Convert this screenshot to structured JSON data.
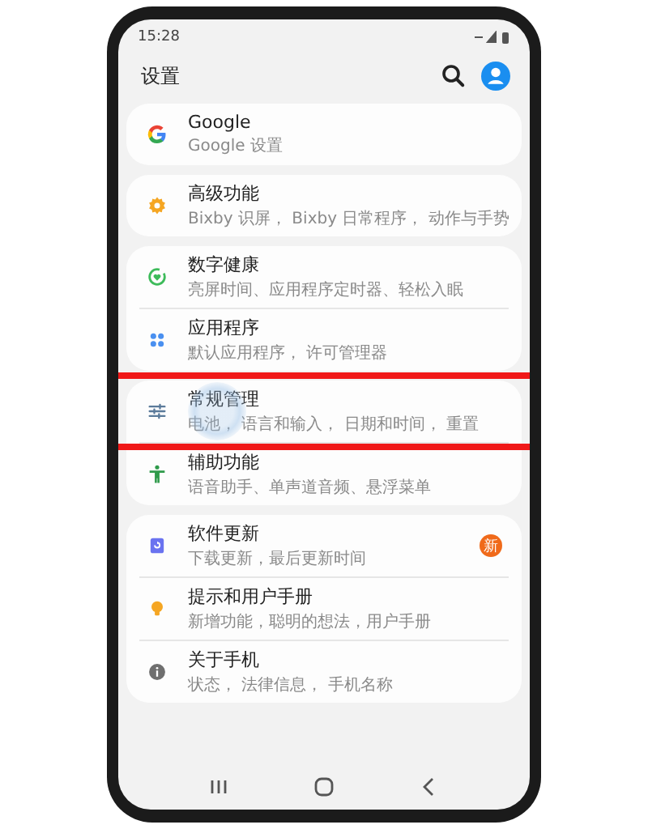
{
  "status_bar": {
    "time": "15:28"
  },
  "header": {
    "title": "设置"
  },
  "groups": [
    {
      "items": [
        {
          "kind": "google",
          "title": "Google",
          "subtitle": "Google 设置",
          "highlighted": false
        }
      ]
    },
    {
      "items": [
        {
          "kind": "gear",
          "title": "高级功能",
          "subtitle": "Bixby 识屏， Bixby 日常程序， 动作与手势",
          "highlighted": false
        }
      ]
    },
    {
      "items": [
        {
          "kind": "wellbeing",
          "title": "数字健康",
          "subtitle": "亮屏时间、应用程序定时器、轻松入眠",
          "highlighted": false
        },
        {
          "kind": "apps",
          "title": "应用程序",
          "subtitle": "默认应用程序， 许可管理器",
          "highlighted": false
        }
      ]
    },
    {
      "items": [
        {
          "kind": "sliders",
          "title": "常规管理",
          "subtitle": "电池， 语言和输入， 日期和时间， 重置",
          "highlighted": true
        },
        {
          "kind": "accessibility",
          "title": "辅助功能",
          "subtitle": "语音助手、单声道音频、悬浮菜单",
          "highlighted": false
        }
      ]
    },
    {
      "items": [
        {
          "kind": "update",
          "title": "软件更新",
          "subtitle": "下载更新，最后更新时间",
          "badge": "新",
          "highlighted": false
        },
        {
          "kind": "bulb",
          "title": "提示和用户手册",
          "subtitle": "新增功能，聪明的想法，用户手册",
          "highlighted": false
        },
        {
          "kind": "info",
          "title": "关于手机",
          "subtitle": "状态， 法律信息， 手机名称",
          "highlighted": false
        }
      ]
    }
  ]
}
